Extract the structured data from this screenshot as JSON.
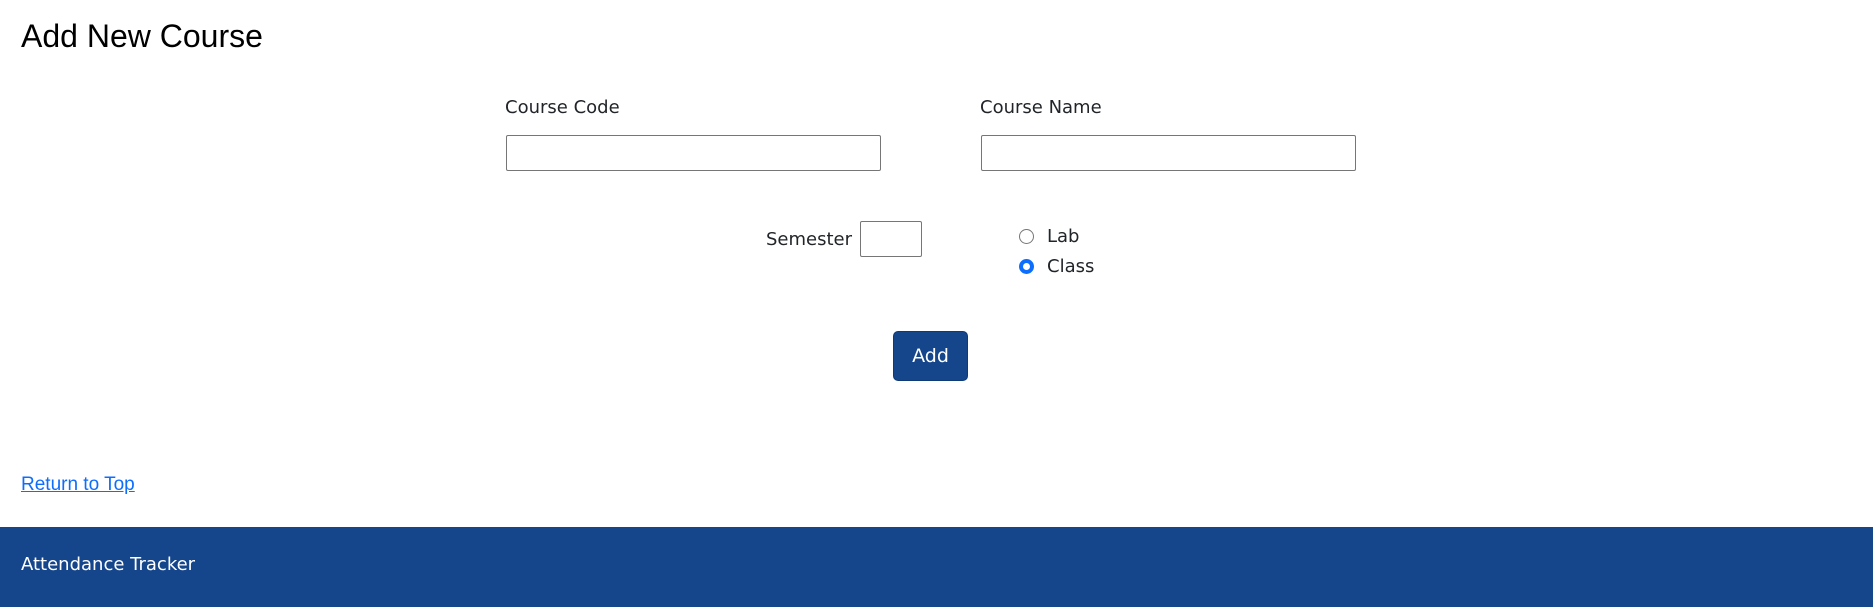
{
  "page": {
    "title": "Add New Course"
  },
  "form": {
    "course_code": {
      "label": "Course Code",
      "value": ""
    },
    "course_name": {
      "label": "Course Name",
      "value": ""
    },
    "semester": {
      "label": "Semester",
      "value": ""
    },
    "type_options": [
      {
        "label": "Lab",
        "checked": false
      },
      {
        "label": "Class",
        "checked": true
      }
    ],
    "submit_label": "Add"
  },
  "links": {
    "return_to_top": "Return to Top"
  },
  "footer": {
    "text": "Attendance Tracker"
  },
  "colors": {
    "brand": "#15458a",
    "link": "#0d6efd",
    "radio_checked": "#0d6efd"
  }
}
